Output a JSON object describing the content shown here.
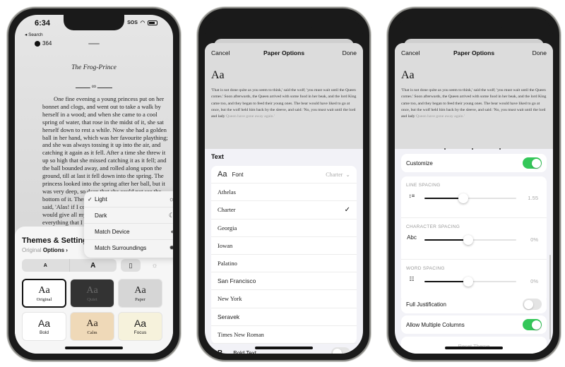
{
  "phone1": {
    "status": {
      "time": "6:34",
      "carrier": "SOS",
      "back_label": "◂ Search"
    },
    "page_count": "364",
    "chapter_title": "The Frog-Prince",
    "body_text": "One fine evening a young princess put on her bonnet and clogs, and went out to take a walk by herself in a wood; and when she came to a cool spring of water, that rose in the midst of it, she sat herself down to rest a while. Now she had a golden ball in her hand, which was her favourite plaything; and she was always tossing it up into the air, and catching it again as it fell. After a time she threw it up so high that she missed catching it as it fell; and the ball bounded away, and rolled along upon the ground, till at last it fell down into the spring. The princess looked into the spring after her ball, but it was very deep, so deep that she could not see the bottom of it. Then she began to bewail her loss, and said, 'Alas! if I could only get my ball again, I would give all my fine clothes and jewels, and everything that I have in the world.'",
    "appearance_menu": {
      "items": [
        {
          "label": "Light",
          "icon": "☼",
          "checked": true
        },
        {
          "label": "Dark",
          "icon": "☾",
          "checked": false
        },
        {
          "label": "Match Device",
          "icon": "◐",
          "checked": false
        },
        {
          "label": "Match Surroundings",
          "icon": "✹",
          "checked": false
        }
      ],
      "check_glyph": "✓"
    },
    "themes_panel": {
      "title": "Themes & Settings",
      "current_theme": "Original",
      "options_label": "Options ›",
      "font_smaller": "A",
      "font_larger": "A",
      "layout_icon": "▯",
      "brightness_icon": "☼",
      "themes": [
        {
          "sample": "Aa",
          "name": "Original",
          "selected": true,
          "bg": "#ffffff",
          "fg": "#111111",
          "serif": true
        },
        {
          "sample": "Aa",
          "name": "Quiet",
          "selected": false,
          "bg": "#333333",
          "fg": "#6a6a6a",
          "serif": true
        },
        {
          "sample": "Aa",
          "name": "Paper",
          "selected": false,
          "bg": "#d6d6d6",
          "fg": "#222222",
          "serif": true
        },
        {
          "sample": "Aa",
          "name": "Bold",
          "selected": false,
          "bg": "#ffffff",
          "fg": "#222222",
          "serif": false
        },
        {
          "sample": "Aa",
          "name": "Calm",
          "selected": false,
          "bg": "#efd9b8",
          "fg": "#2b2118",
          "serif": true
        },
        {
          "sample": "Aa",
          "name": "Focus",
          "selected": false,
          "bg": "#f6f2dc",
          "fg": "#1a1a1a",
          "serif": false
        }
      ]
    }
  },
  "paper_options": {
    "cancel_label": "Cancel",
    "title": "Paper Options",
    "done_label": "Done",
    "preview_sample": "Aa",
    "preview_text": "'That is not done quite as you seem to think,' said the wolf; 'you must wait until the Queen comes.' Soon afterwards, the Queen arrived with some food in her beak, and the lord King came too, and they began to feed their young ones. The bear would have liked to go at once, but the wolf held him back by the sleeve, and said: 'No, you must wait until the lord and lady",
    "preview_text_faded": "Queen have gone away again.'"
  },
  "phone2": {
    "section_title": "Text",
    "font_row": {
      "icon": "Aa",
      "label": "Font",
      "value": "Charter",
      "chevron": "⌄"
    },
    "fonts": [
      {
        "name": "Athelas",
        "selected": false,
        "serif": true
      },
      {
        "name": "Charter",
        "selected": true,
        "serif": true
      },
      {
        "name": "Georgia",
        "selected": false,
        "serif": true
      },
      {
        "name": "Iowan",
        "selected": false,
        "serif": true
      },
      {
        "name": "Palatino",
        "selected": false,
        "serif": true
      },
      {
        "name": "San Francisco",
        "selected": false,
        "serif": false
      },
      {
        "name": "New York",
        "selected": false,
        "serif": true
      },
      {
        "name": "Seravek",
        "selected": false,
        "serif": false
      },
      {
        "name": "Times New Roman",
        "selected": false,
        "serif": true
      }
    ],
    "check_glyph": "✓",
    "bold_text": {
      "icon": "B",
      "label": "Bold Text",
      "on": false
    }
  },
  "phone3": {
    "customize": {
      "label": "Customize",
      "on": true
    },
    "spacing": [
      {
        "label": "LINE SPACING",
        "icon": "↕≡",
        "value_text": "1.55",
        "fraction": 0.42
      },
      {
        "label": "CHARACTER SPACING",
        "icon": "Abc",
        "value_text": "0%",
        "fraction": 0.48
      },
      {
        "label": "WORD SPACING",
        "icon": "☷",
        "value_text": "0%",
        "fraction": 0.48
      }
    ],
    "full_justification": {
      "label": "Full Justification",
      "on": false
    },
    "multiple_columns": {
      "label": "Allow Multiple Columns",
      "on": true
    },
    "reset_label": "Reset Theme"
  }
}
